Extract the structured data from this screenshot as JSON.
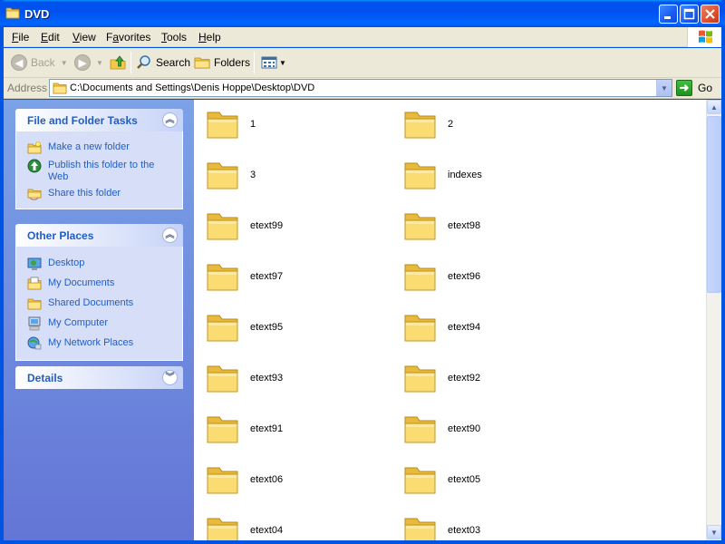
{
  "window": {
    "title": "DVD"
  },
  "menu": [
    {
      "label": "File",
      "ul": "F",
      "rest": "ile"
    },
    {
      "label": "Edit",
      "ul": "E",
      "rest": "dit"
    },
    {
      "label": "View",
      "ul": "V",
      "rest": "iew"
    },
    {
      "label": "Favorites",
      "ul": "F",
      "rest": "avorites",
      "ulIndex": 0,
      "pre": "",
      "special": "Favorites"
    },
    {
      "label": "Tools",
      "ul": "T",
      "rest": "ools"
    },
    {
      "label": "Help",
      "ul": "H",
      "rest": "elp"
    }
  ],
  "toolbar": {
    "back_label": "Back",
    "search_label": "Search",
    "folders_label": "Folders"
  },
  "address": {
    "label": "Address",
    "value": "C:\\Documents and Settings\\Denis Hoppe\\Desktop\\DVD",
    "go_label": "Go"
  },
  "taskpane": {
    "file_tasks": {
      "title": "File and Folder Tasks",
      "items": [
        {
          "label": "Make a new folder",
          "icon": "new-folder-icon"
        },
        {
          "label": "Publish this folder to the Web",
          "icon": "publish-web-icon"
        },
        {
          "label": "Share this folder",
          "icon": "share-folder-icon"
        }
      ]
    },
    "other_places": {
      "title": "Other Places",
      "items": [
        {
          "label": "Desktop",
          "icon": "desktop-icon"
        },
        {
          "label": "My Documents",
          "icon": "my-documents-icon"
        },
        {
          "label": "Shared Documents",
          "icon": "shared-documents-icon"
        },
        {
          "label": "My Computer",
          "icon": "my-computer-icon"
        },
        {
          "label": "My Network Places",
          "icon": "network-places-icon"
        }
      ]
    },
    "details": {
      "title": "Details"
    }
  },
  "folders": [
    "1",
    "2",
    "3",
    "indexes",
    "etext99",
    "etext98",
    "etext97",
    "etext96",
    "etext95",
    "etext94",
    "etext93",
    "etext92",
    "etext91",
    "etext90",
    "etext06",
    "etext05",
    "etext04",
    "etext03"
  ],
  "colors": {
    "titlebar": "#0054e3",
    "link": "#215dc6",
    "taskpane_top": "#7ba2e7",
    "taskpane_bottom": "#6375d6",
    "folder": "#f5d35e"
  }
}
